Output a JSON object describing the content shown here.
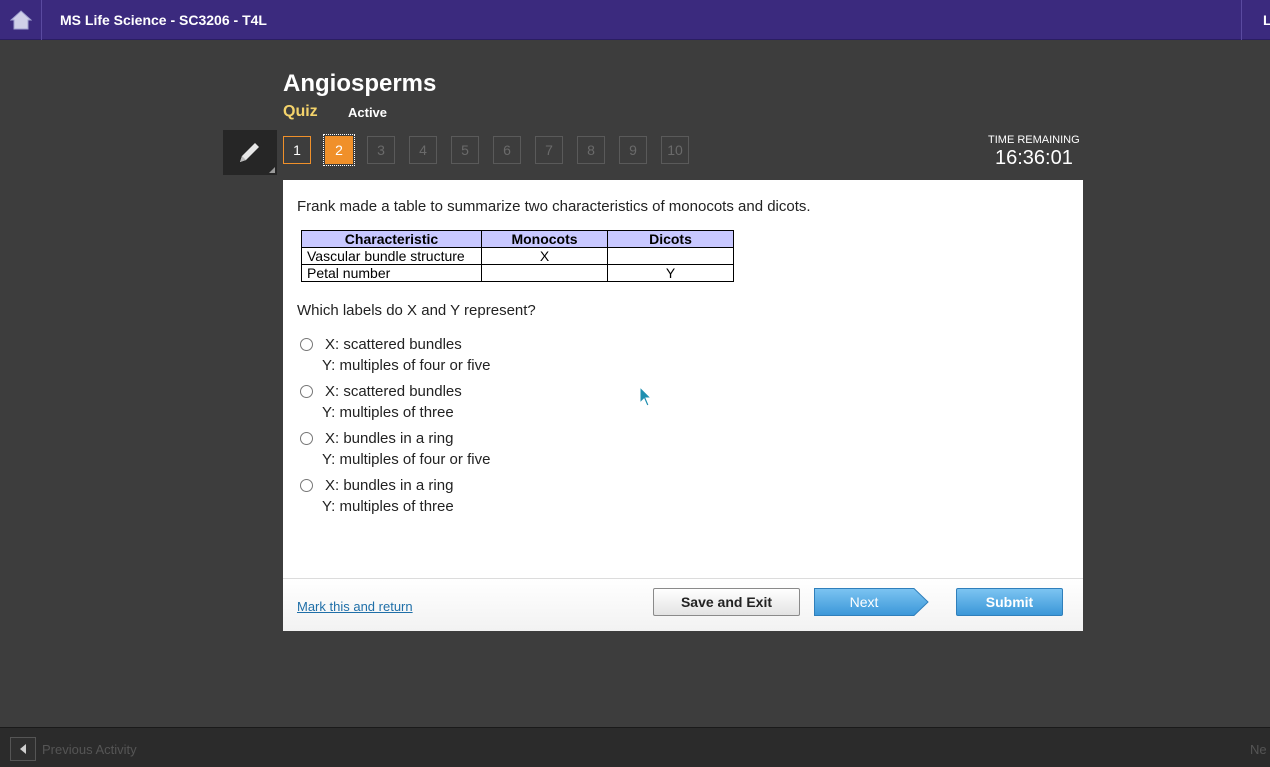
{
  "topbar": {
    "course_title": "MS Life Science - SC3206 - T4L",
    "right_label_clip": "L"
  },
  "header": {
    "title": "Angiosperms",
    "type": "Quiz",
    "status": "Active"
  },
  "nav": {
    "questions": [
      "1",
      "2",
      "3",
      "4",
      "5",
      "6",
      "7",
      "8",
      "9",
      "10"
    ],
    "current": 2
  },
  "timer": {
    "label": "TIME REMAINING",
    "value": "16:36:01"
  },
  "question": {
    "prompt": "Frank made a table to summarize two characteristics of monocots and dicots.",
    "table": {
      "headers": [
        "Characteristic",
        "Monocots",
        "Dicots"
      ],
      "rows": [
        [
          "Vascular bundle structure",
          "X",
          ""
        ],
        [
          "Petal number",
          "",
          "Y"
        ]
      ]
    },
    "text": "Which labels do X and Y represent?",
    "choices": [
      {
        "line1": "X: scattered bundles",
        "line2": "Y: multiples of four or five"
      },
      {
        "line1": "X: scattered bundles",
        "line2": "Y: multiples of three"
      },
      {
        "line1": "X: bundles in a ring",
        "line2": "Y: multiples of four or five"
      },
      {
        "line1": "X: bundles in a ring",
        "line2": "Y: multiples of three"
      }
    ]
  },
  "footer": {
    "mark_link": "Mark this and return",
    "save_exit": "Save and Exit",
    "next": "Next",
    "submit": "Submit"
  },
  "bottombar": {
    "previous": "Previous Activity",
    "next_clip": "Ne"
  },
  "colors": {
    "topbar": "#3b2a7e",
    "accent_orange": "#f0902a",
    "quiz_label": "#f4d36b",
    "button_blue": "#3b97d8"
  }
}
